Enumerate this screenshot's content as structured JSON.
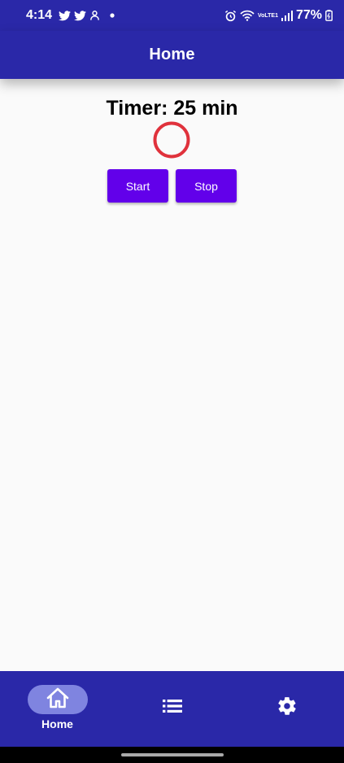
{
  "status_bar": {
    "time": "4:14",
    "battery": "77%",
    "network_label": "VoLTE1",
    "icons_left": [
      "twitter-icon",
      "twitter-icon",
      "android-icon",
      "dot-icon"
    ],
    "icons_right": [
      "alarm-icon",
      "wifi-icon",
      "volte-icon",
      "signal-icon",
      "battery-icon"
    ]
  },
  "app_bar": {
    "title": "Home"
  },
  "timer": {
    "label": "Timer: 25 min",
    "progress": 0,
    "ring_color": "#e0323c"
  },
  "buttons": {
    "start_label": "Start",
    "stop_label": "Stop"
  },
  "bottom_nav": {
    "items": [
      {
        "icon": "home-icon",
        "label": "Home",
        "active": true
      },
      {
        "icon": "list-icon",
        "label": ""
      },
      {
        "icon": "gear-icon",
        "label": ""
      }
    ]
  },
  "colors": {
    "brand": "#2a28a8",
    "button": "#6200ea",
    "active_pill": "#7f84e0",
    "background": "#fafafa"
  }
}
